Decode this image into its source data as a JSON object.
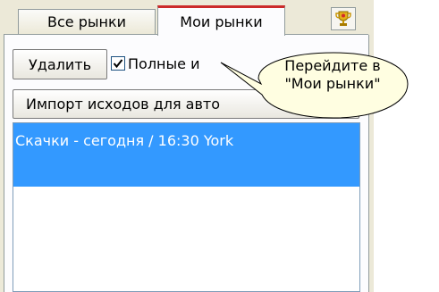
{
  "tabs": [
    {
      "label": "Все рынки",
      "active": false
    },
    {
      "label": "Мои рынки",
      "active": true
    }
  ],
  "icons": {
    "trophy": "trophy-icon",
    "check": "checkmark-icon"
  },
  "toolbar": {
    "delete_label": "Удалить",
    "full_names_label": "Полные и",
    "full_names_checked": true,
    "import_label": "Импорт исходов для авто"
  },
  "markets": [
    {
      "label": "Скачки - сегодня / 16:30 York",
      "selected": true
    }
  ],
  "callout": {
    "line1": "Перейдите в",
    "line2": "\"Мои рынки\""
  },
  "colors": {
    "selection": "#3399ff",
    "active_tab_accent": "#cc2a2a",
    "callout_fill": "#fffee1",
    "panel_bg": "#ece9d8"
  }
}
